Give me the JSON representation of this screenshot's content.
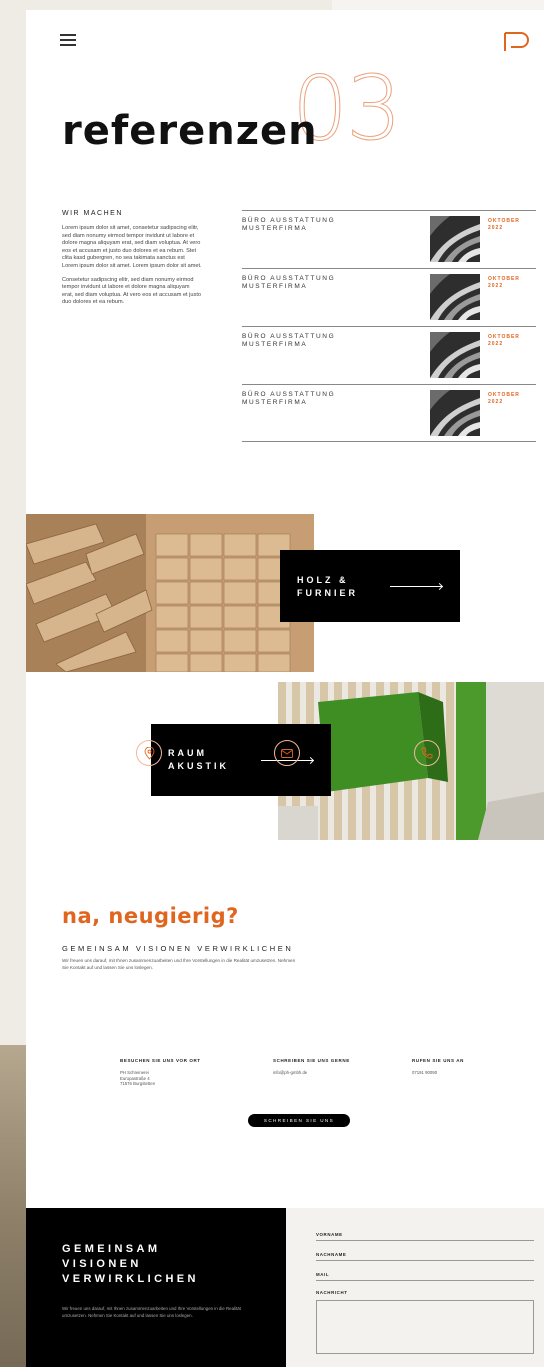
{
  "header": {
    "menu_icon": "hamburger-menu-icon",
    "logo_icon": "logo-icon"
  },
  "hero": {
    "number": "03",
    "title": "referenzen"
  },
  "intro": {
    "heading": "WIR MACHEN",
    "paragraph1": "Lorem ipsum dolor sit amet, consetetur sadipscing elitr, sed diam nonumy eirmod tempor invidunt ut labore et dolore magna aliquyam erat, sed diam voluptua. At vero eos et accusam et justo duo dolores et ea rebum. Stet clita kasd gubergren, no sea takimata sanctus est Lorem ipsum dolor sit amet. Lorem ipsum dolor sit amet.",
    "paragraph2": "Consetetur sadipscing elitr, sed diam nonumy eirmod tempor invidunt ut labore et dolore magna aliquyam erat, sed diam voluptua. At vero eos et accusam et justo duo dolores et ea rebum."
  },
  "references": [
    {
      "title": "BÜRO AUSSTATTUNG MUSTERFIRMA",
      "date": "OKTOBER 2022"
    },
    {
      "title": "BÜRO AUSSTATTUNG MUSTERFIRMA",
      "date": "OKTOBER 2022"
    },
    {
      "title": "BÜRO AUSSTATTUNG MUSTERFIRMA",
      "date": "OKTOBER 2022"
    },
    {
      "title": "BÜRO AUSSTATTUNG MUSTERFIRMA",
      "date": "OKTOBER 2022"
    }
  ],
  "categories": {
    "holz": {
      "label": "HOLZ &\nFURNIER"
    },
    "raum": {
      "label": "RAUM\nAKUSTIK"
    }
  },
  "contact": {
    "heading": "na, neugierig?",
    "subheading": "GEMEINSAM VISIONEN VERWIRKLICHEN",
    "text": "Wir freuen uns darauf, mit Ihnen zusammenzuarbeiten und Ihre Vorstellungen in die Realität umzusetzen. Nehmen Sie Kontakt auf und lassen Sie uns loslegen.",
    "items": [
      {
        "icon": "location-pin-icon",
        "label": "BESUCHEN SIE UNS VOR ORT",
        "value": "PH Schreinerei\nEuropastraße 4\n71576 Burgstetten"
      },
      {
        "icon": "envelope-icon",
        "label": "SCHREIBEN SIE UNS GERNE",
        "value": "info@ph-gmbh.de"
      },
      {
        "icon": "phone-icon",
        "label": "RUFEN SIE UNS AN",
        "value": "07191 90090"
      }
    ],
    "button": "SCHREIBEN SIE UNS"
  },
  "footer": {
    "heading": "GEMEINSAM\nVISIONEN\nVERWIRKLICHEN",
    "text": "Wir freuen uns darauf, mit Ihnen zusammenzuarbeiten und Ihre Vorstellungen in die Realität umzusetzen. Nehmen Sie Kontakt auf und lassen Sie uns loslegen.",
    "form": {
      "vorname": "VORNAME",
      "nachname": "NACHNAME",
      "mail": "MAIL",
      "nachricht": "NACHRICHT"
    }
  },
  "colors": {
    "accent": "#e0651f",
    "dark": "#000000",
    "page": "#ffffff"
  }
}
